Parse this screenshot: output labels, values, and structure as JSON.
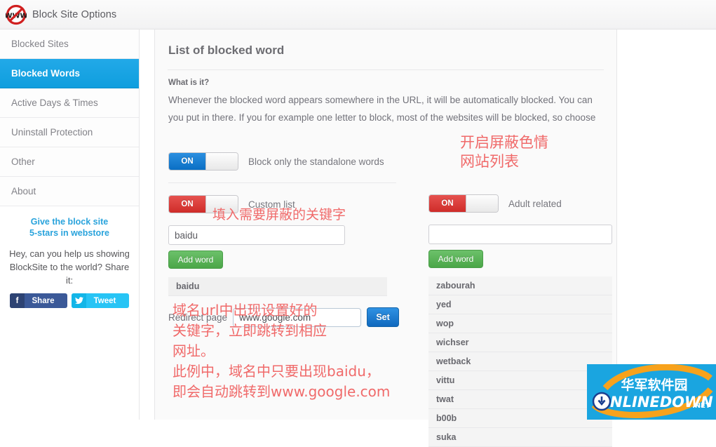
{
  "header": {
    "title": "Block Site Options",
    "logo_icon": "no-www-prohibition-icon"
  },
  "sidebar": {
    "items": [
      {
        "label": "Blocked Sites",
        "active": false
      },
      {
        "label": "Blocked Words",
        "active": true
      },
      {
        "label": "Active Days & Times",
        "active": false
      },
      {
        "label": "Uninstall Protection",
        "active": false
      },
      {
        "label": "Other",
        "active": false
      },
      {
        "label": "About",
        "active": false
      }
    ],
    "promo": {
      "link_line1": "Give the block site",
      "link_line2": "5-stars in webstore",
      "text": "Hey, can you help us showing BlockSite to the world? Share it:",
      "facebook_label": "Share",
      "facebook_icon": "facebook-f-icon",
      "twitter_label": "Tweet",
      "twitter_icon": "twitter-bird-icon"
    }
  },
  "main": {
    "page_title": "List of blocked word",
    "desc_heading": "What is it?",
    "desc_line1": "Whenever the blocked word appears somewhere in the URL, it will be automatically blocked. You can",
    "desc_line2": "you put in there. If you for example one letter to block, most of the websites will be blocked, so choose",
    "left_column": {
      "standalone_toggle": {
        "state": "ON",
        "label": "Block only the standalone words",
        "color": "#1068be"
      },
      "custom_toggle": {
        "state": "ON",
        "label": "Custom list",
        "color": "#cf2c29"
      },
      "input_value": "baidu",
      "input_placeholder": "",
      "add_button": "Add word",
      "words": [
        "baidu"
      ]
    },
    "right_column": {
      "adult_toggle": {
        "state": "ON",
        "label": "Adult related",
        "color": "#cf2c29"
      },
      "input_value": "",
      "input_placeholder": "",
      "add_button": "Add word",
      "words": [
        "zabourah",
        "yed",
        "wop",
        "wichser",
        "wetback",
        "vittu",
        "twat",
        "b00b",
        "suka"
      ]
    },
    "redirect": {
      "label": "Redirect page",
      "value": "www.google.com",
      "placeholder": "",
      "button": "Set"
    }
  },
  "annotations": {
    "adult_note": "开启屏蔽色情\n网站列表",
    "keyword_note": "填入需要屏蔽的关键字",
    "redirect_note": "域名url中出现设置好的\n关键字，立即跳转到相应\n网址。\n此例中，域名中只要出现baidu，\n即会自动跳转到www.google.com",
    "color": "#f06a6a"
  },
  "watermark": {
    "cn_text": "华军软件园",
    "en_text": "ONLINEDOWN",
    "suffix": ".NET",
    "bg_color": "#1aa5e0"
  }
}
